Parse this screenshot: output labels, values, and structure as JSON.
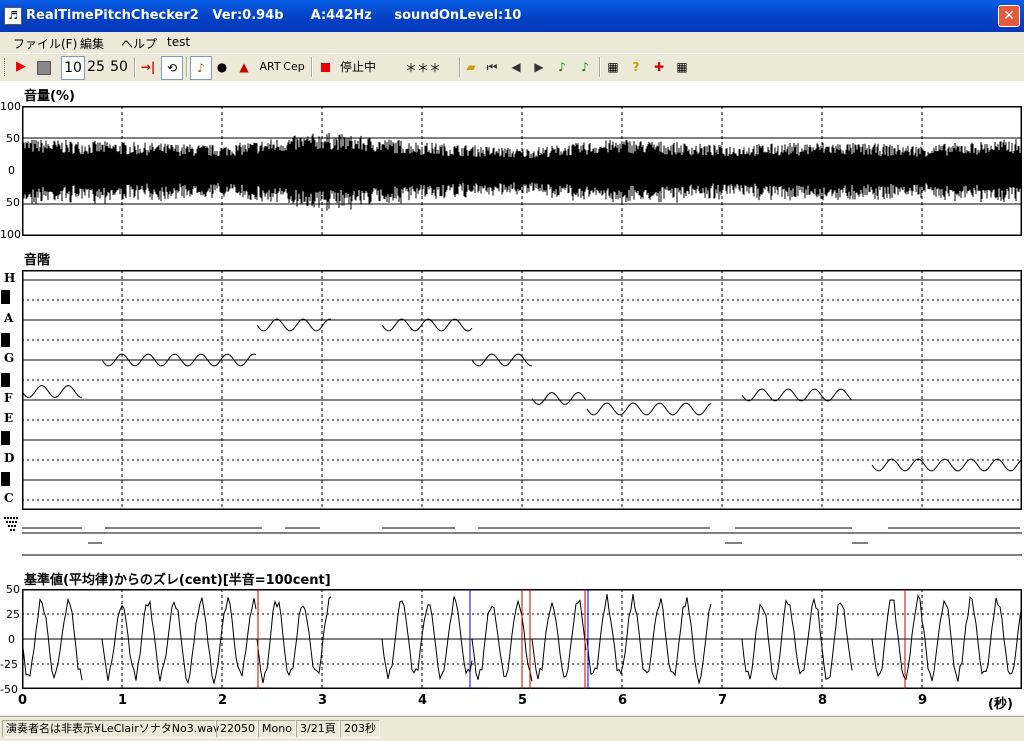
{
  "window": {
    "title": "RealTimePitchChecker2   Ver:0.94b      A:442Hz     soundOnLevel:10",
    "icon": "tuning-fork-icon"
  },
  "menu": [
    "ファイル(F)",
    "編集",
    "ヘルプ",
    "test"
  ],
  "toolbar": {
    "zoom_options": [
      "10",
      "25",
      "50"
    ],
    "art_label": "ART",
    "cep_label": "Cep",
    "status_label": "停止中",
    "display_value": "＊＊＊"
  },
  "panels": {
    "volume": {
      "title": "音量(%)",
      "y_ticks": [
        "100",
        "50",
        "0",
        "50",
        "100"
      ]
    },
    "scale": {
      "title": "音階",
      "notes": [
        "H",
        "A",
        "G",
        "F",
        "E",
        "D",
        "C"
      ]
    },
    "deviation": {
      "title": "基準値(平均律)からのズレ(cent)[半音=100cent]",
      "y_ticks": [
        "50",
        "25",
        "0",
        "-25",
        "-50"
      ]
    },
    "time_axis": {
      "ticks": [
        "0",
        "1",
        "2",
        "3",
        "4",
        "5",
        "6",
        "7",
        "8",
        "9"
      ],
      "unit": "(秒)"
    }
  },
  "chart_data": [
    {
      "type": "line",
      "ylabel": "音量(%)",
      "ylim": [
        -100,
        100
      ],
      "xlim": [
        0,
        10
      ],
      "grid": true,
      "description_series": "audio waveform amplitude",
      "x": [
        0,
        1,
        2,
        3,
        4,
        5,
        6,
        7,
        8,
        9,
        10
      ],
      "series": [
        {
          "values_envelope": [
            50,
            45,
            40,
            60,
            45,
            35,
            50,
            40,
            45,
            40,
            50
          ]
        }
      ]
    },
    {
      "type": "line",
      "xlim": [
        0,
        10
      ],
      "categories": [
        "C",
        "D",
        "E",
        "F",
        "G",
        "A",
        "H"
      ],
      "pitch_segments": [
        {
          "x": [
            0.0,
            0.6
          ],
          "note": "F",
          "level": 3.1
        },
        {
          "x": [
            0.8,
            2.35
          ],
          "note": "G",
          "level": 4.0
        },
        {
          "x": [
            2.35,
            3.1
          ],
          "note": "A",
          "level": 5.0
        },
        {
          "x": [
            3.6,
            4.5
          ],
          "note": "A",
          "level": 5.0
        },
        {
          "x": [
            4.5,
            5.1
          ],
          "note": "G",
          "level": 4.0
        },
        {
          "x": [
            5.1,
            5.65
          ],
          "note": "F",
          "level": 2.9
        },
        {
          "x": [
            5.65,
            6.9
          ],
          "note": "E",
          "level": 2.6
        },
        {
          "x": [
            7.2,
            8.3
          ],
          "note": "F",
          "level": 3.0
        },
        {
          "x": [
            8.5,
            10.0
          ],
          "note": "D",
          "level": 1.0
        }
      ]
    },
    {
      "type": "line",
      "ylabel": "cent",
      "ylim": [
        -50,
        50
      ],
      "xlim": [
        0,
        10
      ],
      "grid": true
    }
  ],
  "status": {
    "file": "演奏者名は非表示¥LeClairソナタNo3.wav",
    "rate": "22050",
    "channels": "Mono",
    "page": "3/21頁",
    "length": "203秒"
  }
}
